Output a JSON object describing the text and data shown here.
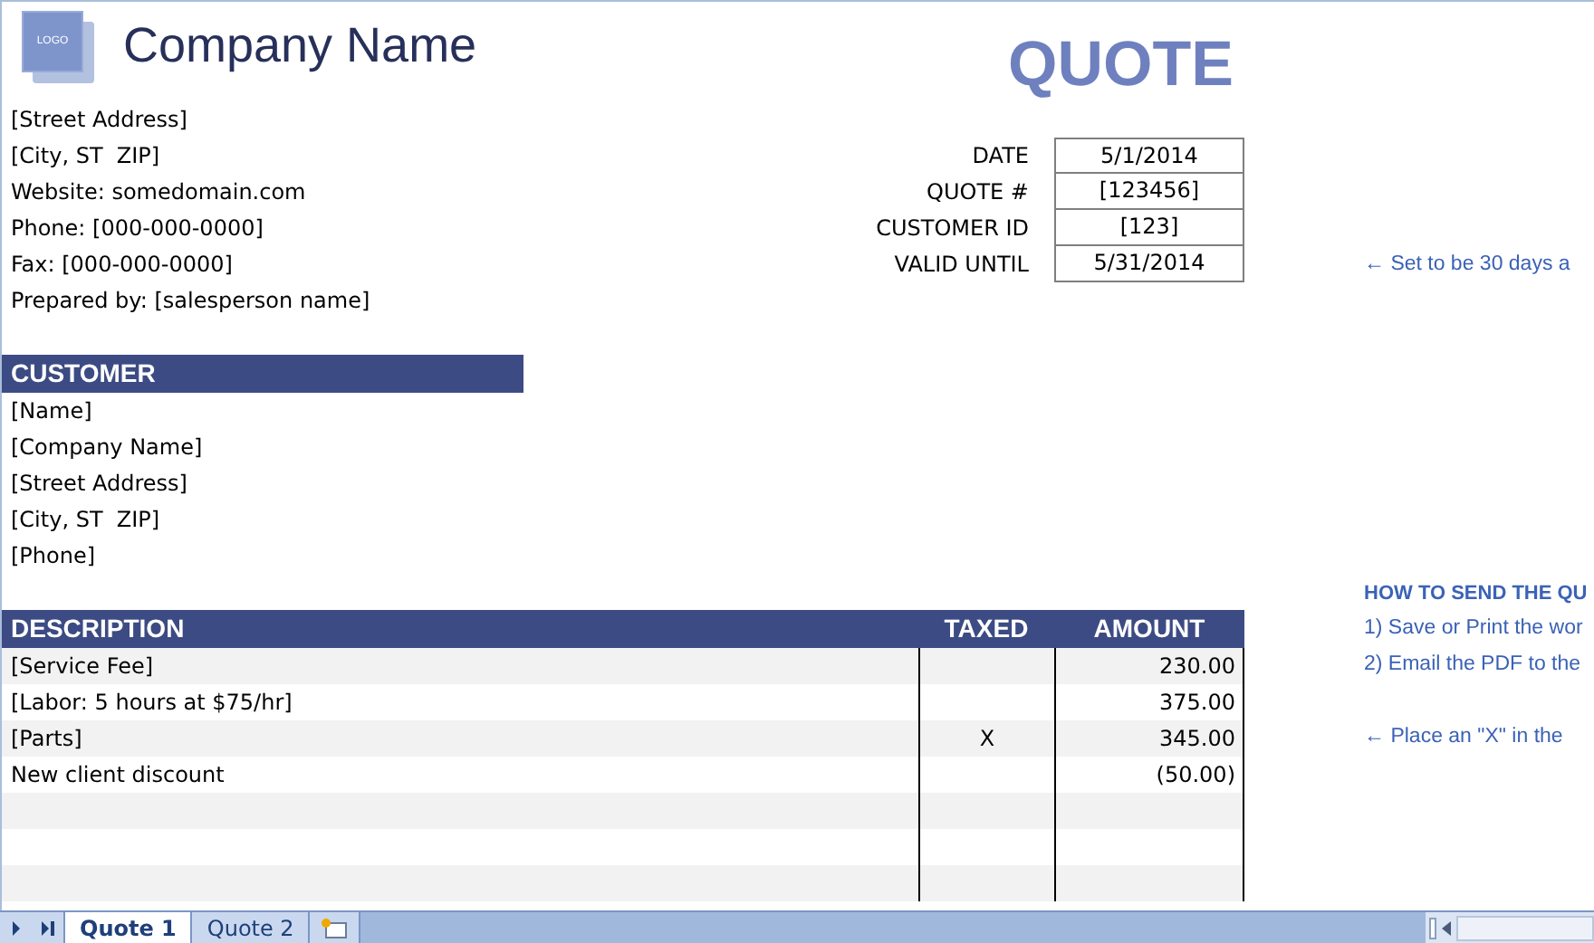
{
  "logo": {
    "text": "LOGO"
  },
  "company_name": "Company Name",
  "document_title": "QUOTE",
  "company_details": [
    "[Street Address]",
    "[City, ST  ZIP]",
    "Website: somedomain.com",
    "Phone: [000-000-0000]",
    "Fax: [000-000-0000]",
    "Prepared by: [salesperson name]"
  ],
  "quote_info": [
    {
      "label": "DATE",
      "value": "5/1/2014"
    },
    {
      "label": "QUOTE #",
      "value": "[123456]"
    },
    {
      "label": "CUSTOMER ID",
      "value": "[123]"
    },
    {
      "label": "VALID UNTIL",
      "value": "5/31/2014"
    }
  ],
  "customer": {
    "heading": "CUSTOMER",
    "lines": [
      "[Name]",
      "[Company Name]",
      "[Street Address]",
      "[City, ST  ZIP]",
      "[Phone]"
    ]
  },
  "items_table": {
    "columns": [
      "DESCRIPTION",
      "TAXED",
      "AMOUNT"
    ],
    "rows": [
      {
        "description": "[Service Fee]",
        "amount": "230.00"
      },
      {
        "description": "[Labor: 5 hours at $75/hr]",
        "amount": "375.00"
      },
      {
        "description": "[Parts]",
        "taxed": "X",
        "amount": "345.00"
      },
      {
        "description": "New client discount",
        "amount": "(50.00)"
      }
    ]
  },
  "notes": {
    "valid_until_note": "← Set to be 30 days a",
    "how_to_heading": "HOW TO SEND THE QU",
    "steps": [
      "1) Save or Print the wor",
      "2) Email the PDF to the "
    ],
    "taxed_note": "← Place an \"X\" in the "
  },
  "sheet_tabs": [
    {
      "label": "Quote 1",
      "selected": true
    },
    {
      "label": "Quote 2",
      "selected": false
    }
  ]
}
